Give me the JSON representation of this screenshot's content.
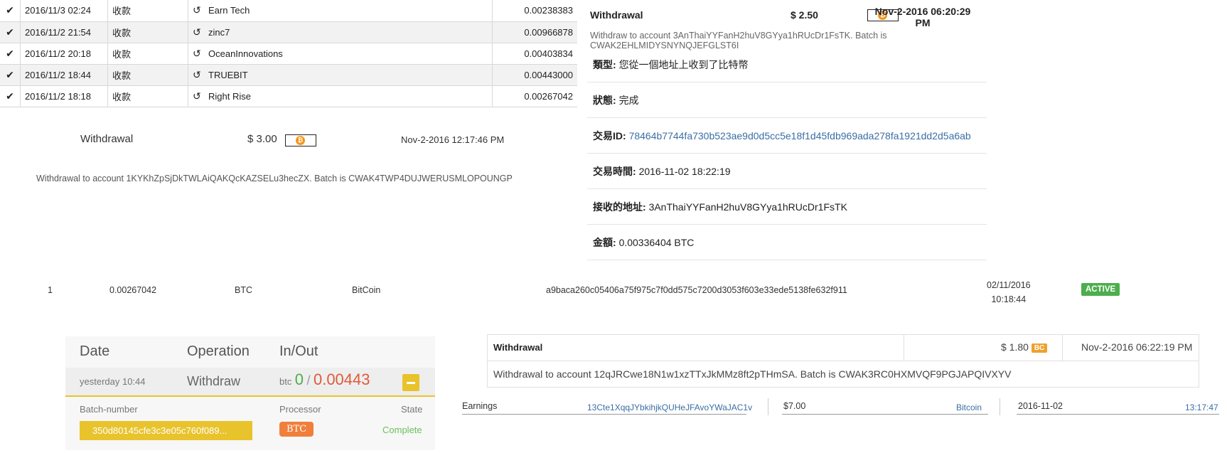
{
  "tx_table": {
    "rows": [
      {
        "date": "2016/11/3 02:24",
        "type": "收款",
        "name": "Earn Tech",
        "amount": "0.00238383"
      },
      {
        "date": "2016/11/2 21:54",
        "type": "收款",
        "name": "zinc7",
        "amount": "0.00966878"
      },
      {
        "date": "2016/11/2 20:18",
        "type": "收款",
        "name": "OceanInnovations",
        "amount": "0.00403834"
      },
      {
        "date": "2016/11/2 18:44",
        "type": "收款",
        "name": "TRUEBIT",
        "amount": "0.00443000"
      },
      {
        "date": "2016/11/2 18:18",
        "type": "收款",
        "name": "Right Rise",
        "amount": "0.00267042"
      }
    ]
  },
  "withdrawal_1": {
    "title": "Withdrawal",
    "amount": "$ 3.00",
    "date": "Nov-2-2016 12:17:46 PM",
    "text": "Withdrawal to account 1KYKhZpSjDkTWLAiQAKQcKAZSELu3hecZX. Batch is CWAK4TWP4DUJWERUSMLOPOUNGP"
  },
  "withdrawal_2": {
    "title": "Withdrawal",
    "amount": "$ 2.50",
    "date_line1": "Nov-2-2016 06:20:29",
    "date_line2": "PM",
    "text_line1": "Withdraw to account 3AnThaiYYFanH2huV8GYya1hRUcDr1FsTK. Batch is",
    "text_line2": "CWAK2EHLMIDYSNYNQJEFGLST6I"
  },
  "details": [
    {
      "label": "類型:",
      "value": "您從一個地址上收到了比特幣"
    },
    {
      "label": "狀態:",
      "value": "完成"
    },
    {
      "label": "交易ID:",
      "value": "78464b7744fa730b523ae9d0d5cc5e18f1d45fdb969ada278fa1921dd2d5a6ab"
    },
    {
      "label": "交易時間:",
      "value": "2016-11-02 18:22:19"
    },
    {
      "label": "接收的地址:",
      "value": "3AnThaiYYFanH2huV8GYya1hRUcDr1FsTK"
    },
    {
      "label": "金額:",
      "value": "0.00336404 BTC"
    }
  ],
  "row_btc": {
    "index": "1",
    "amount": "0.00267042",
    "currency": "BTC",
    "name": "BitCoin",
    "hash": "a9baca260c05406a75f975c7f0dd575c7200d3053f603e33ede5138fe632f911",
    "date": "02/11/2016",
    "time": "10:18:44",
    "status": "ACTIVE"
  },
  "panel_op": {
    "headers": [
      "Date",
      "Operation",
      "In/Out"
    ],
    "date": "yesterday 10:44",
    "operation": "Withdraw",
    "currency": "btc",
    "in": "0",
    "sep": "/",
    "out": "0.00443",
    "batch_label": "Batch-number",
    "processor_label": "Processor",
    "state_label": "State",
    "batch_value": "350d80145cfe3c3e05c760f089...",
    "processor_value": "BTC",
    "state_value": "Complete"
  },
  "withdrawal_3": {
    "title": "Withdrawal",
    "amount": "$ 1.80",
    "badge": "BC",
    "date": "Nov-2-2016 06:22:19 PM",
    "text": "Withdrawal to account 12qJRCwe18N1w1xzTTxJkMMz8ft2pTHmSA. Batch is CWAK3RC0HXMVQF9PGJAPQIVXYV"
  },
  "earnings_row": {
    "label": "Earnings",
    "address": "13Cte1XqqJYbkihjkQUHeJFAvoYWaJAC1v",
    "amount": "$7.00",
    "currency": "Bitcoin",
    "date": "2016-11-02",
    "time": "13:17:47"
  },
  "colors": {
    "accent_green": "#4cae4c",
    "orange": "#f07f3c",
    "yellow": "#e8c32c",
    "link": "#3a6ea5"
  }
}
